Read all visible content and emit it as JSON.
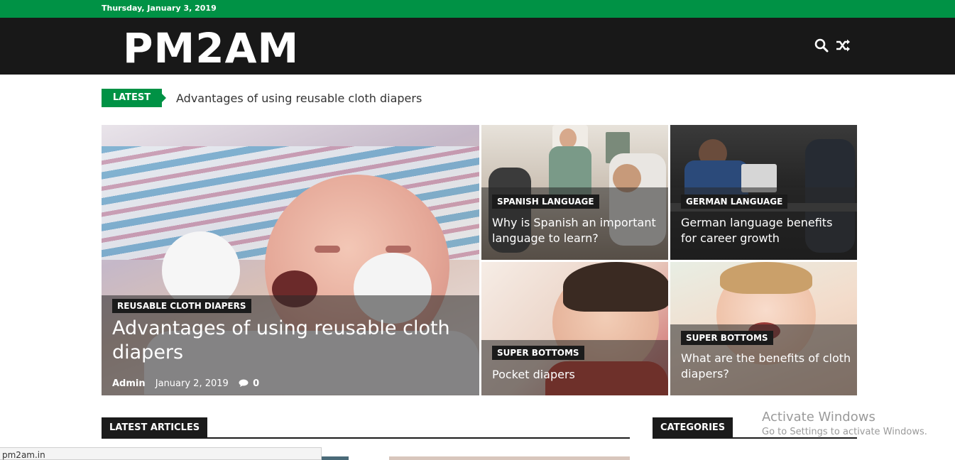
{
  "topbar": {
    "date": "Thursday, January 3, 2019"
  },
  "header": {
    "logo": "PM2AM",
    "icons": [
      "search-icon",
      "shuffle-icon"
    ]
  },
  "ticker": {
    "tag": "LATEST",
    "headline": "Advantages of using reusable cloth diapers"
  },
  "featured": {
    "main": {
      "category": "REUSABLE CLOTH DIAPERS",
      "title": "Advantages of using reusable cloth diapers",
      "author": "Admin",
      "date": "January 2, 2019",
      "comments": "0"
    },
    "tiles": [
      {
        "category": "SPANISH LANGUAGE",
        "title": "Why is Spanish an important language to learn?"
      },
      {
        "category": "GERMAN LANGUAGE",
        "title": "German language benefits for career growth"
      },
      {
        "category": "SUPER BOTTOMS",
        "title": "Pocket diapers"
      },
      {
        "category": "SUPER BOTTOMS",
        "title": "What are the benefits of cloth diapers?"
      }
    ]
  },
  "sections": {
    "latest": "LATEST ARTICLES",
    "categories": "CATEGORIES"
  },
  "watermark": {
    "line1": "Activate Windows",
    "line2": "Go to Settings to activate Windows."
  },
  "status": {
    "url": "pm2am.in"
  },
  "colors": {
    "brand_green": "#009245",
    "header_dark": "#181818"
  }
}
